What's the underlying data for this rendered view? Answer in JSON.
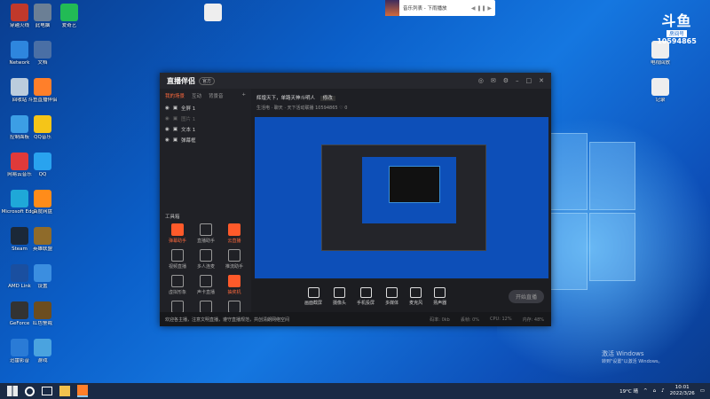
{
  "desktop": {
    "icons_col1": [
      {
        "label": "穿越火线",
        "color": "#c0392b"
      },
      {
        "label": "Network",
        "color": "#2e86de"
      },
      {
        "label": "回收站",
        "color": "#bcd"
      },
      {
        "label": "控制面板",
        "color": "#3c9ee5"
      },
      {
        "label": "网易云音乐",
        "color": "#e03a3a"
      },
      {
        "label": "Microsoft Edge",
        "color": "#1fa8d8"
      },
      {
        "label": "Steam",
        "color": "#1b2838"
      },
      {
        "label": "AMD Link",
        "color": "#1a4fa0"
      },
      {
        "label": "GeForce",
        "color": "#333"
      },
      {
        "label": "迅雷影音",
        "color": "#2a7bd6"
      }
    ],
    "icons_col2": [
      {
        "label": "此电脑",
        "color": "#6b7f95"
      },
      {
        "label": "文档",
        "color": "#4a6fa5"
      },
      {
        "label": "斗鱼直播伴侣",
        "color": "#ff7f2a"
      },
      {
        "label": "QQ音乐",
        "color": "#f5c518"
      },
      {
        "label": "QQ",
        "color": "#29a3ef"
      },
      {
        "label": "百度网盘",
        "color": "#ff8c1a"
      },
      {
        "label": "英雄联盟",
        "color": "#8f6b2a"
      },
      {
        "label": "设置",
        "color": "#3b8ee0"
      },
      {
        "label": "红色警戒",
        "color": "#6c4d1f"
      },
      {
        "label": "游戏",
        "color": "#4aa3df"
      }
    ],
    "icons_col3": [
      {
        "label": "爱奇艺",
        "color": "#22bb55"
      },
      {
        "label": "",
        "color": "#eee"
      }
    ],
    "right_icons": [
      {
        "label": "电视回放",
        "color": "#eee"
      },
      {
        "label": "记录",
        "color": "#eee"
      }
    ]
  },
  "toast": {
    "text": "音乐列表 - 下雨播放",
    "controls": "◀ ❚❚ ▶"
  },
  "douyu": {
    "logo": "斗鱼",
    "room_label": "房间号",
    "room_number": "10594865"
  },
  "app": {
    "title": "直播伴侣",
    "version": "官方",
    "left_tabs": [
      "我的场景",
      "互动",
      "背景音"
    ],
    "scenes": [
      "全屏 1",
      "图片 1",
      "文本 1",
      "弹幕框"
    ],
    "tools_title": "工具箱",
    "tools": [
      {
        "label": "弹幕助手",
        "hot": true
      },
      {
        "label": "直播助手",
        "hot": false
      },
      {
        "label": "云直播",
        "hot": true
      },
      {
        "label": "视频直播",
        "hot": false
      },
      {
        "label": "多人连麦",
        "hot": false
      },
      {
        "label": "推流助手",
        "hot": false
      },
      {
        "label": "虚拟形象",
        "hot": false
      },
      {
        "label": "声卡直播",
        "hot": false
      },
      {
        "label": "抽奖机",
        "hot": true
      },
      {
        "label": "美颜",
        "hot": false
      },
      {
        "label": "弹幕游戏",
        "hot": false
      },
      {
        "label": "更多",
        "hot": false
      }
    ],
    "stream_title": "辉煌天下，单路天神斗明人",
    "stream_tag": "修改",
    "stream_meta": "生活电 · 聊天 · 天下活动联播 10594865 ♡ 0",
    "bottom_buttons": [
      "画面截屏",
      "摄像头",
      "手机投屏",
      "多媒体",
      "麦克风",
      "扬声器"
    ],
    "start_button": "开始直播",
    "notice": "欢迎各主播，注意文明直播，遵守直播规范，共创清朗网络空间",
    "stats": [
      "码率: 0kb",
      "丢帧: 0%",
      "CPU: 12%",
      "内存: 48%"
    ]
  },
  "activation": {
    "title": "激活 Windows",
    "sub": "转到\"设置\"以激活 Windows。"
  },
  "taskbar": {
    "weather": "19°C 晴",
    "time": "10:01",
    "date": "2022/3/26"
  }
}
